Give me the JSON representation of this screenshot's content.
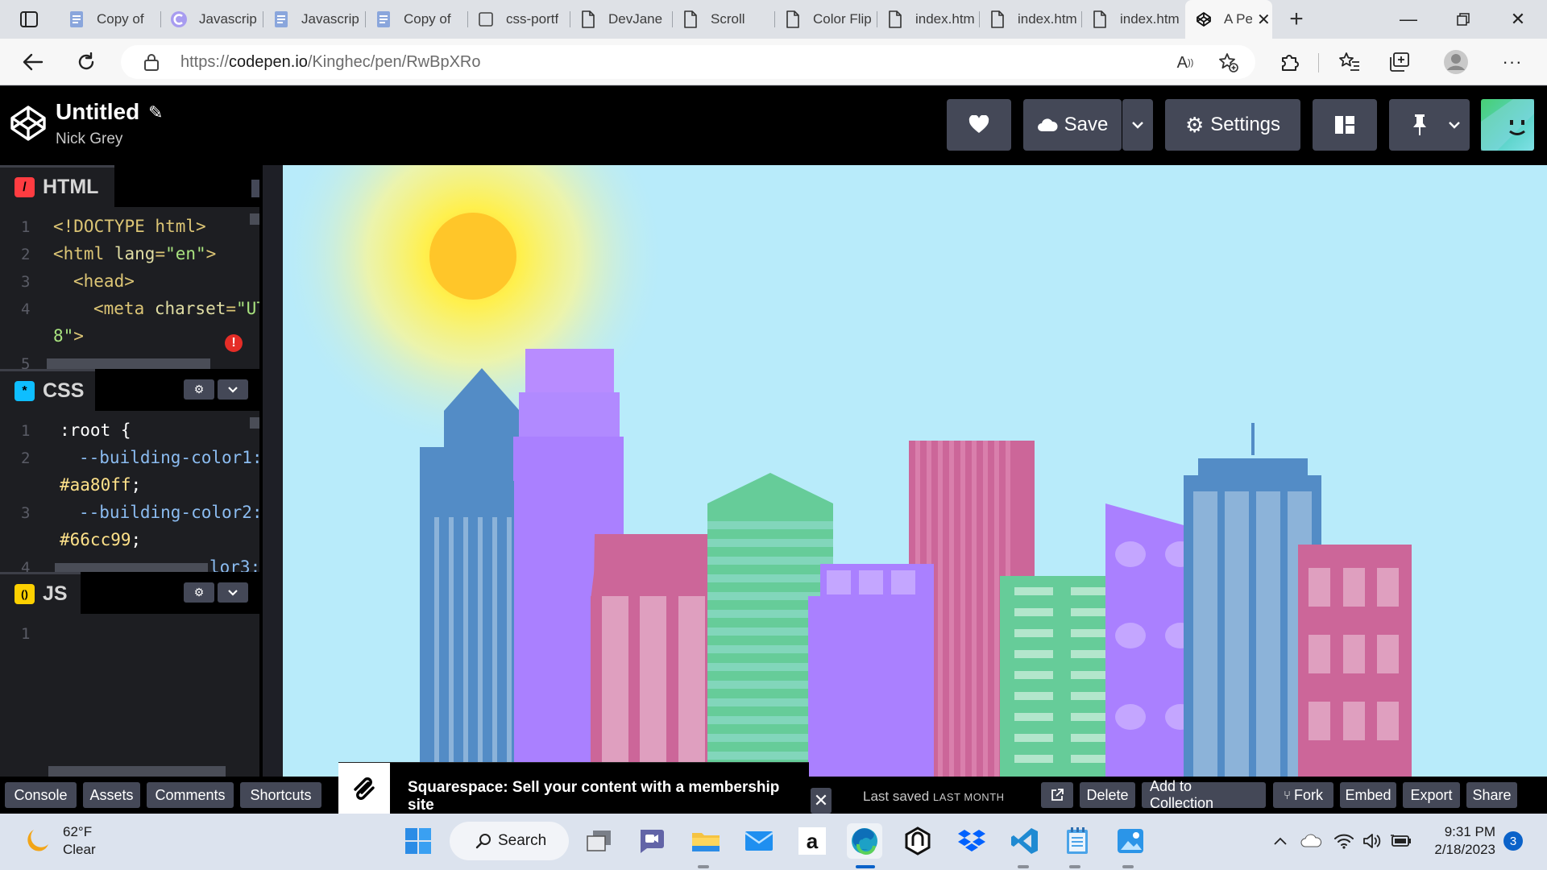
{
  "browser": {
    "tabs": [
      {
        "label": "Copy of",
        "icon": "docs-icon"
      },
      {
        "label": "Javascrip",
        "icon": "c-logo-icon"
      },
      {
        "label": "Javascrip",
        "icon": "docs-icon"
      },
      {
        "label": "Copy of",
        "icon": "docs-icon"
      },
      {
        "label": "css-portf",
        "icon": "blank-page-icon"
      },
      {
        "label": "DevJane",
        "icon": "page-icon"
      },
      {
        "label": "Scroll",
        "icon": "page-icon"
      },
      {
        "label": "Color Flip",
        "icon": "page-icon"
      },
      {
        "label": "index.htm",
        "icon": "page-icon"
      },
      {
        "label": "index.htm",
        "icon": "page-icon"
      },
      {
        "label": "index.htm",
        "icon": "page-icon"
      }
    ],
    "active_tab": {
      "label": "A Pe",
      "icon": "codepen-icon"
    },
    "url_prefix": "https://",
    "url_host": "codepen.io",
    "url_path": "/Kinghec/pen/RwBpXRo"
  },
  "codepen": {
    "title": "Untitled",
    "author": "Nick Grey",
    "save_label": "Save",
    "settings_label": "Settings",
    "accent": "#47cf73"
  },
  "editors": {
    "html": {
      "label": "HTML",
      "badge": "/",
      "badge_color": "#ff3c41",
      "lines": [
        {
          "n": "1",
          "parts": [
            {
              "c": "tag",
              "t": "<!DOCTYPE html>"
            }
          ]
        },
        {
          "n": "2",
          "parts": [
            {
              "c": "tag",
              "t": "<html "
            },
            {
              "c": "attr",
              "t": "lang"
            },
            {
              "c": "tag",
              "t": "="
            },
            {
              "c": "str",
              "t": "\"en\""
            },
            {
              "c": "tag",
              "t": ">"
            }
          ]
        },
        {
          "n": "3",
          "parts": [
            {
              "c": "tag",
              "t": "<head>"
            }
          ]
        },
        {
          "n": "4",
          "parts": [
            {
              "c": "tag",
              "t": "<meta "
            },
            {
              "c": "attr",
              "t": "charset"
            },
            {
              "c": "tag",
              "t": "="
            },
            {
              "c": "str",
              "t": "\"UT"
            }
          ]
        },
        {
          "n": "",
          "parts": [
            {
              "c": "str",
              "t": "8\""
            },
            {
              "c": "tag",
              "t": ">"
            }
          ]
        },
        {
          "n": "5",
          "parts": []
        }
      ]
    },
    "css": {
      "label": "CSS",
      "badge": "*",
      "badge_color": "#0ebeff",
      "lines": [
        {
          "n": "1",
          "parts": [
            {
              "c": "sel",
              "t": ":root {"
            }
          ]
        },
        {
          "n": "2",
          "parts": [
            {
              "c": "var",
              "t": "--building-color1:"
            }
          ]
        },
        {
          "n": "",
          "parts": [
            {
              "c": "val",
              "t": "#aa80ff"
            },
            {
              "c": "sel",
              "t": ";"
            }
          ]
        },
        {
          "n": "3",
          "parts": [
            {
              "c": "var",
              "t": "--building-color2:"
            }
          ]
        },
        {
          "n": "",
          "parts": [
            {
              "c": "val",
              "t": "#66cc99"
            },
            {
              "c": "sel",
              "t": ";"
            }
          ]
        },
        {
          "n": "4",
          "parts": [
            {
              "c": "var",
              "t": "lor3:"
            }
          ]
        }
      ]
    },
    "js": {
      "label": "JS",
      "badge": "()",
      "badge_color": "#fcd000",
      "lines": [
        {
          "n": "1",
          "parts": []
        }
      ]
    }
  },
  "preview": {
    "sky_color": "#b8ebfa",
    "sun_color": "#ffc629",
    "colors": {
      "purple": "#aa80ff",
      "green": "#66cc99",
      "pink": "#cc6699",
      "blue": "#538cc6",
      "light_blue": "#8cb3d9",
      "light_pink": "#df9fbf",
      "dark_purple": "#9966cc"
    }
  },
  "bottombar": {
    "left_buttons": [
      "Console",
      "Assets",
      "Comments",
      "Shortcuts"
    ],
    "ad_text": "Squarespace: Sell your content with a membership site",
    "last_saved": "Last saved",
    "last_saved_when": "LAST MONTH",
    "right_buttons": [
      "Delete",
      "Add to Collection",
      "Fork",
      "Embed",
      "Export",
      "Share"
    ]
  },
  "taskbar": {
    "temp": "62°F",
    "condition": "Clear",
    "search_label": "Search",
    "time": "9:31 PM",
    "date": "2/18/2023",
    "notifications": "3"
  }
}
